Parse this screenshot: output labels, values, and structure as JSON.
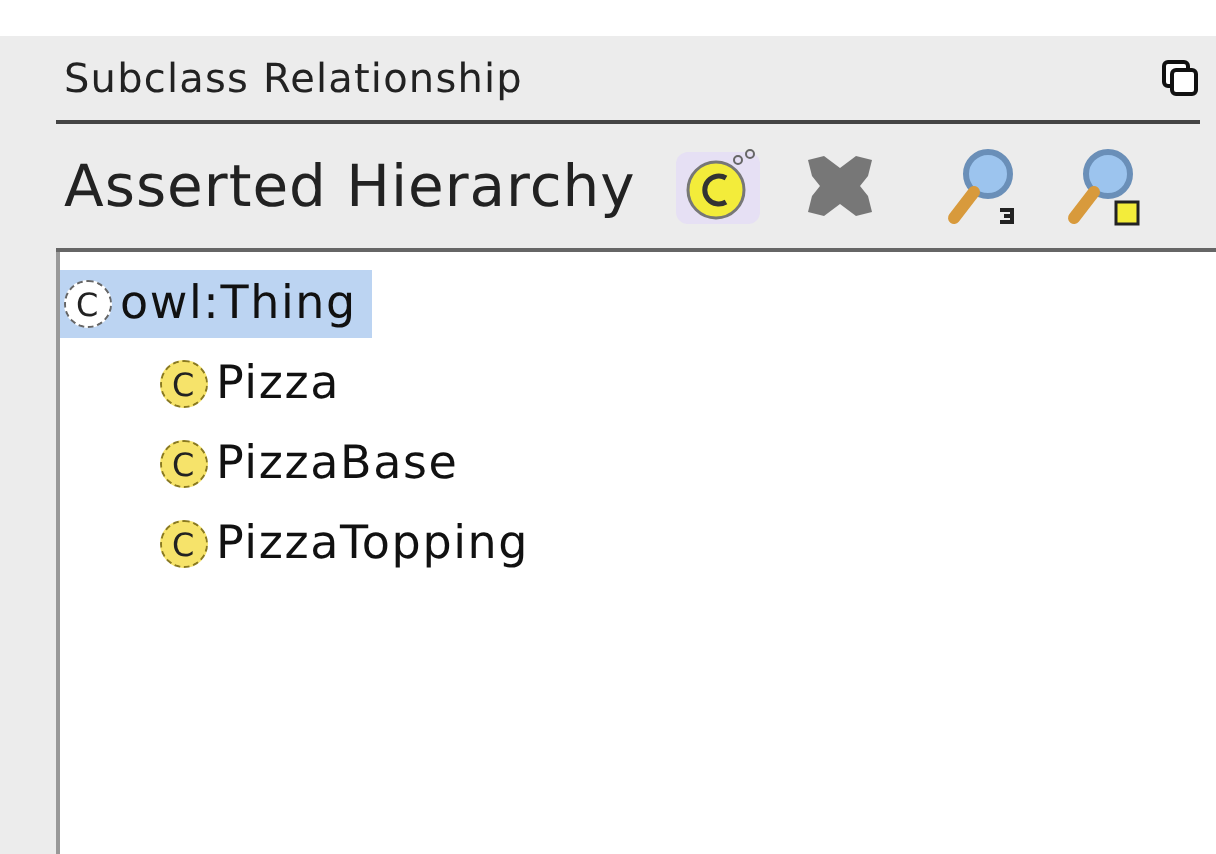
{
  "view": {
    "title": "Subclass Relationship"
  },
  "hierarchy": {
    "title": "Asserted Hierarchy",
    "tree": [
      {
        "icon": "C",
        "label": "owl:Thing",
        "kind": "thing",
        "selected": true,
        "children": [
          {
            "icon": "C",
            "label": "Pizza",
            "kind": "class",
            "selected": false
          },
          {
            "icon": "C",
            "label": "PizzaBase",
            "kind": "class",
            "selected": false
          },
          {
            "icon": "C",
            "label": "PizzaTopping",
            "kind": "class",
            "selected": false
          }
        ]
      }
    ]
  }
}
